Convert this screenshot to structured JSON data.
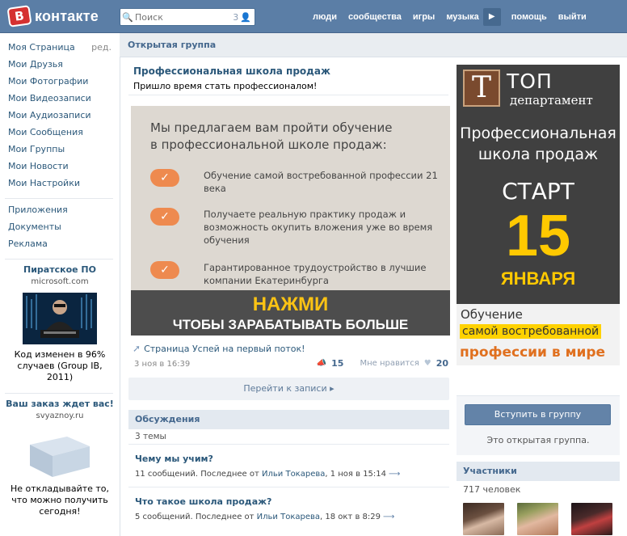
{
  "header": {
    "logo_badge": "B",
    "logo_text": "контакте",
    "search_placeholder": "Поиск",
    "search_count": "3",
    "nav": [
      "люди",
      "сообщества",
      "игры",
      "музыка",
      "помощь",
      "выйти"
    ]
  },
  "sidebar": {
    "menu": [
      {
        "label": "Моя Страница",
        "extra": "ред."
      },
      {
        "label": "Мои Друзья"
      },
      {
        "label": "Мои Фотографии"
      },
      {
        "label": "Мои Видеозаписи"
      },
      {
        "label": "Мои Аудиозаписи"
      },
      {
        "label": "Мои Сообщения"
      },
      {
        "label": "Мои Группы"
      },
      {
        "label": "Мои Новости"
      },
      {
        "label": "Мои Настройки"
      }
    ],
    "menu2": [
      "Приложения",
      "Документы",
      "Реклама"
    ],
    "ad1": {
      "title": "Пиратское ПО",
      "domain": "microsoft.com",
      "text": "Код изменен в 96% случаев (Group IB, 2011)"
    },
    "ad2": {
      "title": "Ваш заказ ждет вас!",
      "domain": "svyaznoy.ru",
      "text": "Не откладывайте то, что можно получить сегодня!"
    }
  },
  "main": {
    "header": "Открытая группа",
    "group_title": "Профессиональная школа продаж",
    "group_status": "Пришло время стать профессионалом!",
    "post_image": {
      "headline_1": "Мы предлагаем вам пройти обучение",
      "headline_2": "в профессиональной школе продаж:",
      "items": [
        "Обучение самой востребованной профессии 21 века",
        "Получаете реальную практику продаж и возможность окупить вложения уже во время обучения",
        "Гарантированное трудоустройство в лучшие компании Екатеринбурга"
      ],
      "cta_1": "НАЖМИ",
      "cta_2": "ЧТОБЫ ЗАРАБАТЫВАТЬ БОЛЬШЕ"
    },
    "post_link": "Страница Успей на первый поток!",
    "post_date": "3 ноя в 16:39",
    "shares": "15",
    "like_label": "Мне нравится",
    "likes": "20",
    "goto_posts": "Перейти к записи",
    "discussions_header": "Обсуждения",
    "discussions_count": "3 темы",
    "topics": [
      {
        "title": "Чему мы учим?",
        "meta_prefix": "11 сообщений. Последнее от ",
        "author": "Ильи Токарева",
        "when": ", 1 ноя в 15:14"
      },
      {
        "title": "Что такое школа продаж?",
        "meta_prefix": "5 сообщений. Последнее от ",
        "author": "Ильи Токарева",
        "when": ", 18 окт в 8:29"
      }
    ]
  },
  "right": {
    "banner": {
      "logo_letter": "Т",
      "brand_1": "ТОП",
      "brand_2": "департамент",
      "pro_1": "Профессиональная",
      "pro_2": "школа продаж",
      "start": "СТАРТ",
      "day": "15",
      "month": "ЯНВАРЯ",
      "line_1": "Обучение",
      "line_2": "самой востребованной",
      "line_3": "профессии в мире"
    },
    "join_button": "Вступить в группу",
    "join_note": "Это открытая группа.",
    "members_header": "Участники",
    "members_count": "717 человек"
  },
  "colors": {
    "header_bg": "#5b7ea6",
    "link": "#2b587a",
    "accent_orange": "#ee8a4f",
    "accent_yellow": "#ffc900"
  }
}
